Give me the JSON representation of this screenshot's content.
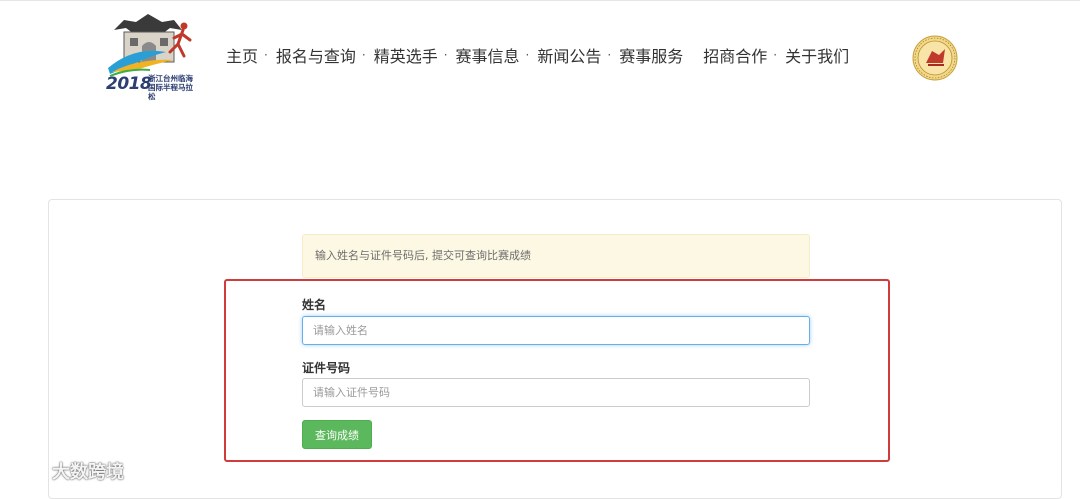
{
  "logo": {
    "year": "2018",
    "subtitle": "浙江台州临海国际半程马拉松"
  },
  "nav": {
    "items": [
      {
        "label": "主页",
        "sep": "·"
      },
      {
        "label": "报名与查询",
        "sep": "·"
      },
      {
        "label": "精英选手",
        "sep": "·"
      },
      {
        "label": "赛事信息",
        "sep": "·"
      },
      {
        "label": "新闻公告",
        "sep": "·"
      },
      {
        "label": "赛事服务",
        "sep": ""
      },
      {
        "label": "招商合作",
        "sep": "·"
      },
      {
        "label": "关于我们",
        "sep": ""
      }
    ]
  },
  "form": {
    "notice": "输入姓名与证件号码后, 提交可查询比赛成绩",
    "name_label": "姓名",
    "name_placeholder": "请输入姓名",
    "name_value": "",
    "id_label": "证件号码",
    "id_placeholder": "请输入证件号码",
    "id_value": "",
    "submit_label": "查询成绩"
  },
  "watermark": {
    "text": "大数跨境"
  },
  "colors": {
    "button": "#5cb85c",
    "notice_bg": "#fcf8e3",
    "highlight": "#d03c3c",
    "focus": "#66afe9"
  }
}
